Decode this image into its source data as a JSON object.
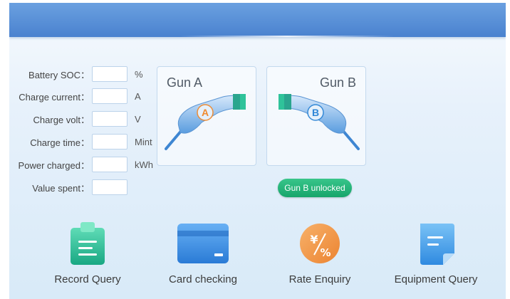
{
  "fields": [
    {
      "label": "Battery SOC：",
      "unit": "%",
      "value": ""
    },
    {
      "label": "Charge current：",
      "unit": "A",
      "value": ""
    },
    {
      "label": "Charge volt：",
      "unit": "V",
      "value": ""
    },
    {
      "label": "Charge time：",
      "unit": "Mint",
      "value": ""
    },
    {
      "label": "Power charged：",
      "unit": "kWh",
      "value": ""
    },
    {
      "label": "Value spent：",
      "unit": "",
      "value": ""
    }
  ],
  "guns": {
    "a": {
      "title": "Gun A",
      "letter": "A",
      "letter_color": "#f08a2e"
    },
    "b": {
      "title": "Gun B",
      "letter": "B",
      "letter_color": "#2f86d6"
    }
  },
  "status_badge": {
    "label": "Gun B unlocked",
    "color": "#1fb075"
  },
  "menu": [
    {
      "label": "Record Query",
      "icon": "clipboard-icon"
    },
    {
      "label": "Card checking",
      "icon": "card-icon"
    },
    {
      "label": "Rate Enquiry",
      "icon": "yen-percent-icon"
    },
    {
      "label": "Equipment Query",
      "icon": "document-icon"
    }
  ],
  "colors": {
    "header": "#5a92d8",
    "accent_green": "#1fb075",
    "accent_orange": "#f08a2e",
    "accent_blue": "#2f86d6"
  }
}
